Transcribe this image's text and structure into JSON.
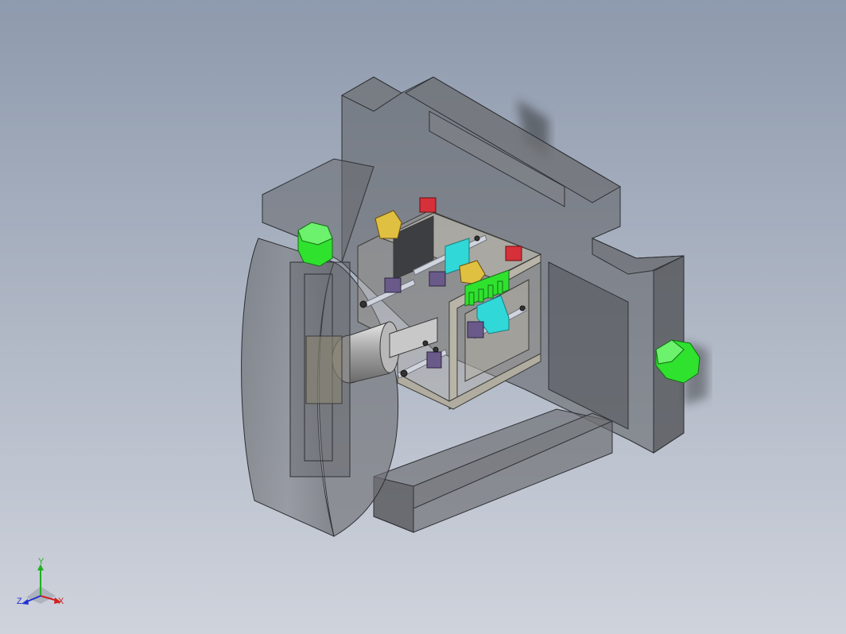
{
  "viewport": {
    "background_top": "#8e9aad",
    "background_bottom": "#cfd3dc"
  },
  "model": {
    "housing_color": "#5f6166",
    "frame_color": "#a8a49a",
    "motor_color": "#2ee22e",
    "sensor_red": "#d6303a",
    "fitting_yellow": "#e0c040",
    "block_cyan": "#30d8d8",
    "block_purple": "#6a5a8a",
    "rod_color": "#d0d4dc"
  },
  "triad": {
    "x_label": "X",
    "y_label": "Y",
    "z_label": "Z",
    "x_color": "#d02020",
    "y_color": "#20b020",
    "z_color": "#2030d0"
  }
}
